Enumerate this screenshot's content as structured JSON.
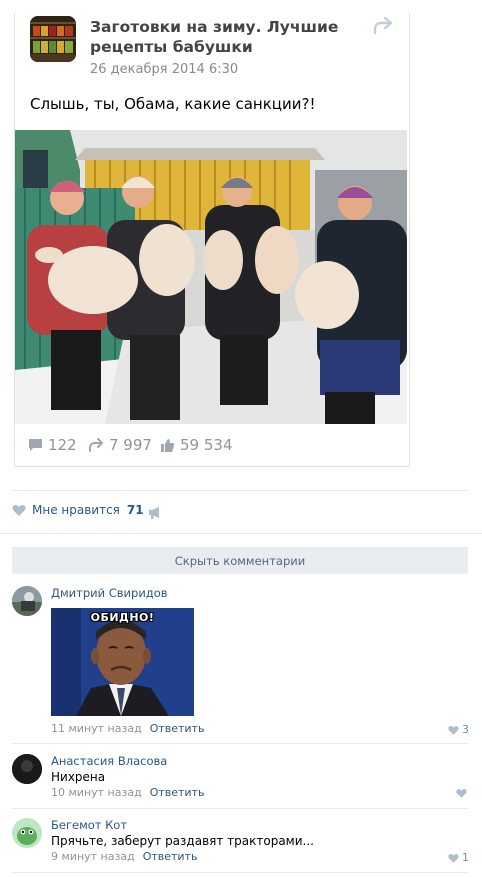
{
  "post": {
    "group_name": "Заготовки на зиму. Лучшие рецепты бабушки",
    "date": "26 декабря 2014 6:30",
    "text": "Слышь, ты, Обама, какие санкции?!",
    "stats": {
      "comments": "122",
      "reposts": "7 997",
      "likes": "59 534"
    }
  },
  "like_bar": {
    "label": "Мне нравится",
    "count": "71"
  },
  "hide_comments_label": "Скрыть комментарии",
  "comments": [
    {
      "author": "Дмитрий Свиридов",
      "sticker_caption": "ОБИДНО!",
      "time": "11 минут назад",
      "reply": "Ответить",
      "likes": "3"
    },
    {
      "author": "Анастасия Власова",
      "text": "Нихрена",
      "time": "10 минут назад",
      "reply": "Ответить",
      "likes": ""
    },
    {
      "author": "Бегемот Кот",
      "text": "Прячьте, заберут раздавят тракторами...",
      "time": "9 минут назад",
      "reply": "Ответить",
      "likes": "1"
    }
  ],
  "colors": {
    "link": "#2a5885",
    "muted": "#939393",
    "bar": "#e9ecf0"
  }
}
